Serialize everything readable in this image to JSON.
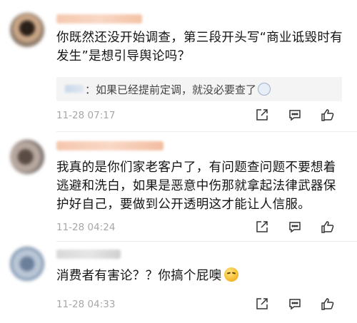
{
  "comments": [
    {
      "text": "你既然还没开始调查，第三段开头写“商业诋毁时有发生”是想引导舆论吗？",
      "reply": {
        "text": "：如果已经提前定调，就没必要查了"
      },
      "time": "11-28 07:17"
    },
    {
      "text": "我真的是你们家老客户了，有问题查问题不要想着逃避和洗白，如果是恶意中伤那就拿起法律武器保护好自己，要做到公开透明这才能让人信服。",
      "time": "11-28 04:24"
    },
    {
      "text": "消费者有害论？？你搞个屁噢",
      "time": "11-28 04:33"
    }
  ],
  "icons": {
    "share": "share-icon",
    "comment": "comment-icon",
    "like": "like-icon"
  },
  "colors": {
    "timestamp": "#a7a7a7",
    "reply_background": "#f4f4f4",
    "icon": "#333333"
  }
}
